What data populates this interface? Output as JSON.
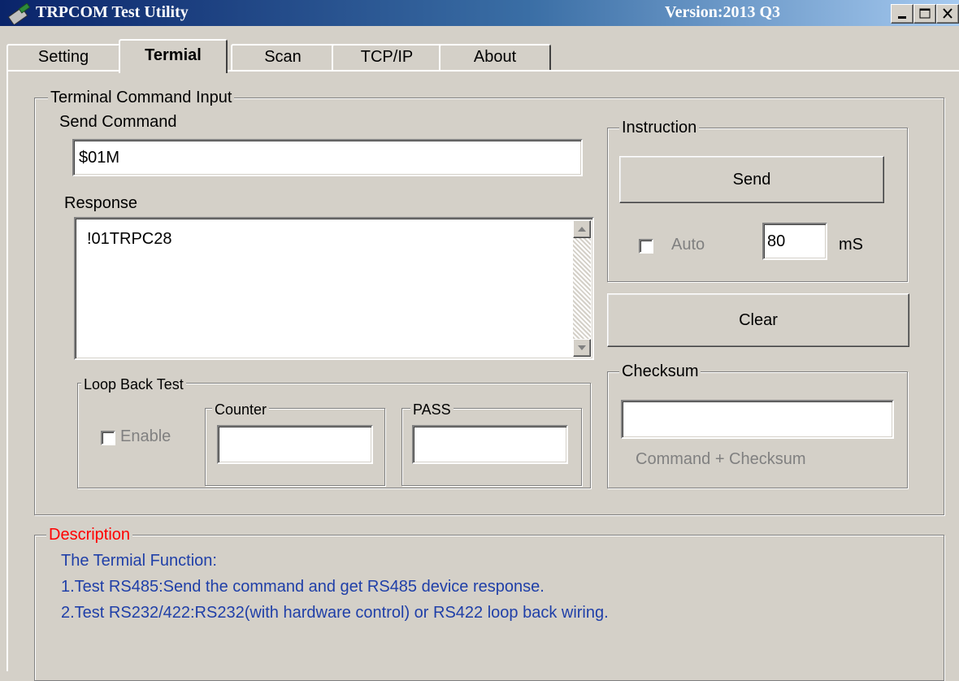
{
  "window": {
    "title": "TRPCOM Test Utility",
    "version": "Version:2013 Q3"
  },
  "tabs": [
    {
      "label": "Setting"
    },
    {
      "label": "Termial"
    },
    {
      "label": "Scan"
    },
    {
      "label": "TCP/IP"
    },
    {
      "label": "About"
    }
  ],
  "terminal": {
    "group_title": "Terminal Command Input",
    "send_command_label": "Send Command",
    "send_command_value": "$01M",
    "response_label": "Response",
    "response_value": "!01TRPC28"
  },
  "instruction": {
    "group_title": "Instruction",
    "send_label": "Send",
    "auto_label": "Auto",
    "interval_value": "80",
    "unit_label": "mS"
  },
  "clear_label": "Clear",
  "checksum": {
    "group_title": "Checksum",
    "value": "",
    "hint": "Command + Checksum"
  },
  "loopback": {
    "group_title": "Loop Back Test",
    "enable_label": "Enable",
    "counter_title": "Counter",
    "counter_value": "",
    "pass_title": "PASS",
    "pass_value": ""
  },
  "description": {
    "group_title": "Description",
    "lines": [
      "The Termial Function:",
      "1.Test RS485:Send the command and get  RS485 device response.",
      "2.Test RS232/422:RS232(with hardware control) or RS422 loop back wiring."
    ]
  },
  "colors": {
    "description_title": "#ff0000",
    "description_text": "#1f3fa8",
    "window_bg": "#d4d0c8"
  }
}
